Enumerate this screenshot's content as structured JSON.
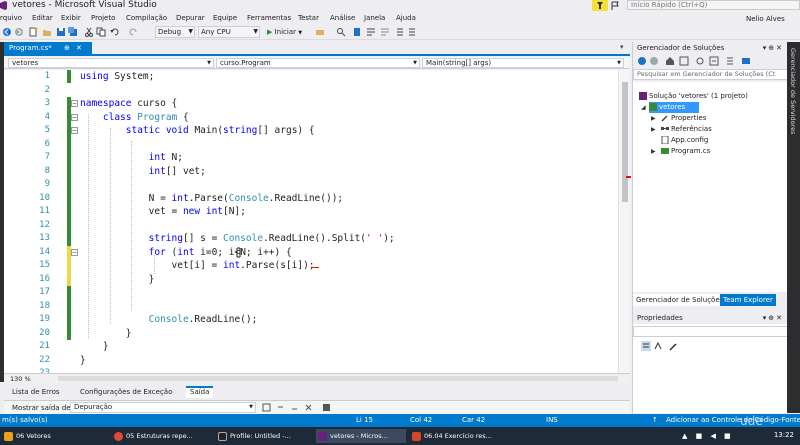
{
  "titlebar": {
    "title": "vetores - Microsoft Visual Studio",
    "quick_launch_placeholder": "Início Rápido (Ctrl+Q)"
  },
  "menu": {
    "items": [
      "rquivo",
      "Editar",
      "Exibir",
      "Projeto",
      "Compilação",
      "Depurar",
      "Equipe",
      "Ferramentas",
      "Testar",
      "Análise",
      "Janela",
      "Ajuda"
    ],
    "user": "Nelio Alves"
  },
  "toolbar": {
    "config": "Debug",
    "platform": "Any CPU",
    "start": "Iniciar"
  },
  "editor": {
    "tab_label": "Program.cs*",
    "nav": {
      "project": "vetores",
      "class": "curso.Program",
      "member": "Main(string[] args)"
    },
    "zoom": "130 %",
    "lines": [
      {
        "n": "1",
        "tokens": [
          {
            "c": "k",
            "t": "using"
          },
          {
            "c": "i",
            "t": " System;"
          }
        ]
      },
      {
        "n": "2",
        "tokens": []
      },
      {
        "n": "3",
        "tokens": [
          {
            "c": "k",
            "t": "namespace"
          },
          {
            "c": "i",
            "t": " curso {"
          }
        ]
      },
      {
        "n": "4",
        "tokens": [
          {
            "c": "i",
            "t": "    "
          },
          {
            "c": "k",
            "t": "class"
          },
          {
            "c": "i",
            "t": " "
          },
          {
            "c": "t",
            "t": "Program"
          },
          {
            "c": "i",
            "t": " {"
          }
        ]
      },
      {
        "n": "5",
        "tokens": [
          {
            "c": "i",
            "t": "        "
          },
          {
            "c": "k",
            "t": "static"
          },
          {
            "c": "i",
            "t": " "
          },
          {
            "c": "k",
            "t": "void"
          },
          {
            "c": "i",
            "t": " Main("
          },
          {
            "c": "k",
            "t": "string"
          },
          {
            "c": "i",
            "t": "[] args) {"
          }
        ]
      },
      {
        "n": "6",
        "tokens": []
      },
      {
        "n": "7",
        "tokens": [
          {
            "c": "i",
            "t": "            "
          },
          {
            "c": "k",
            "t": "int"
          },
          {
            "c": "i",
            "t": " N;"
          }
        ]
      },
      {
        "n": "8",
        "tokens": [
          {
            "c": "i",
            "t": "            "
          },
          {
            "c": "k",
            "t": "int"
          },
          {
            "c": "i",
            "t": "[] vet;"
          }
        ]
      },
      {
        "n": "9",
        "tokens": []
      },
      {
        "n": "10",
        "tokens": [
          {
            "c": "i",
            "t": "            N = "
          },
          {
            "c": "k",
            "t": "int"
          },
          {
            "c": "i",
            "t": ".Parse("
          },
          {
            "c": "t",
            "t": "Console"
          },
          {
            "c": "i",
            "t": ".ReadLine());"
          }
        ]
      },
      {
        "n": "11",
        "tokens": [
          {
            "c": "i",
            "t": "            vet = "
          },
          {
            "c": "k",
            "t": "new"
          },
          {
            "c": "i",
            "t": " "
          },
          {
            "c": "k",
            "t": "int"
          },
          {
            "c": "i",
            "t": "[N];"
          }
        ]
      },
      {
        "n": "12",
        "tokens": []
      },
      {
        "n": "13",
        "tokens": [
          {
            "c": "i",
            "t": "            "
          },
          {
            "c": "k",
            "t": "string"
          },
          {
            "c": "i",
            "t": "[] s = "
          },
          {
            "c": "t",
            "t": "Console"
          },
          {
            "c": "i",
            "t": ".ReadLine().Split("
          },
          {
            "c": "s",
            "t": "' '"
          },
          {
            "c": "i",
            "t": ");"
          }
        ]
      },
      {
        "n": "14",
        "tokens": [
          {
            "c": "i",
            "t": "            "
          },
          {
            "c": "k",
            "t": "for"
          },
          {
            "c": "i",
            "t": " ("
          },
          {
            "c": "k",
            "t": "int"
          },
          {
            "c": "i",
            "t": " i=0; i<N; i++) {"
          }
        ]
      },
      {
        "n": "15",
        "tokens": [
          {
            "c": "i",
            "t": "                vet[i] = "
          },
          {
            "c": "k",
            "t": "int"
          },
          {
            "c": "i",
            "t": ".Parse(s[i]);"
          }
        ]
      },
      {
        "n": "16",
        "tokens": [
          {
            "c": "i",
            "t": "            }"
          }
        ]
      },
      {
        "n": "17",
        "tokens": []
      },
      {
        "n": "18",
        "tokens": []
      },
      {
        "n": "19",
        "tokens": [
          {
            "c": "i",
            "t": "            "
          },
          {
            "c": "t",
            "t": "Console"
          },
          {
            "c": "i",
            "t": ".ReadLine();"
          }
        ]
      },
      {
        "n": "20",
        "tokens": [
          {
            "c": "i",
            "t": "        }"
          }
        ]
      },
      {
        "n": "21",
        "tokens": [
          {
            "c": "i",
            "t": "    }"
          }
        ]
      },
      {
        "n": "22",
        "tokens": [
          {
            "c": "i",
            "t": "}"
          }
        ]
      },
      {
        "n": "23",
        "tokens": []
      }
    ]
  },
  "bottom_panel": {
    "tabs": [
      "Lista de Erros",
      "Configurações de Exceção",
      "Saída"
    ],
    "output_label": "Mostrar saída de:",
    "output_source": "Depuração"
  },
  "solution_explorer": {
    "title": "Gerenciador de Soluções",
    "search_placeholder": "Pesquisar em Gerenciador de Soluções (Ct",
    "tree": [
      {
        "label": "Solução 'vetores' (1 projeto)"
      },
      {
        "label": "vetores"
      },
      {
        "label": "Properties"
      },
      {
        "label": "Referências"
      },
      {
        "label": "App.config"
      },
      {
        "label": "Program.cs"
      }
    ],
    "tabs": [
      "Gerenciador de Soluções",
      "Team Explorer"
    ]
  },
  "properties": {
    "title": "Propriedades"
  },
  "right_strip_label": "Gerenciador de Servidores",
  "statusbar": {
    "left": "m(s) salvo(s)",
    "line": "Li 15",
    "col": "Col 42",
    "char": "Car 42",
    "mode": "INS",
    "source_control": "Adicionar ao Controle do Código-Fonte"
  },
  "taskbar": {
    "items": [
      "06 Vetores",
      "05 Estruturas repe...",
      "Profile: Untitled -...",
      "vetores - Micros...",
      "06.04 Exercício res..."
    ],
    "clock": "13:22"
  },
  "watermark": "ude"
}
